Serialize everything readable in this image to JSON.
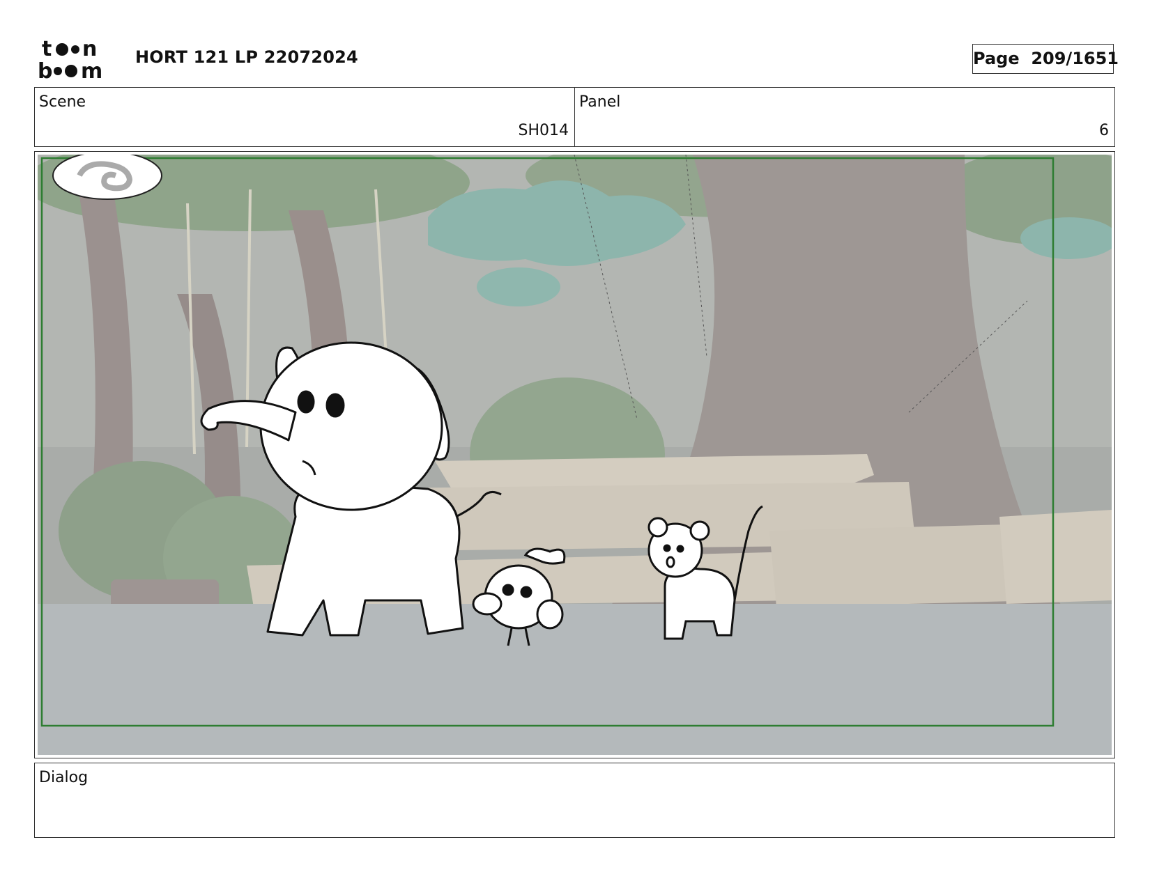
{
  "header": {
    "logo_text": "toon boom",
    "project_title": "HORT 121 LP 22072024",
    "page_label": "Page",
    "page_number": "209/1651"
  },
  "info": {
    "scene_label": "Scene",
    "scene_value": "SH014",
    "panel_label": "Panel",
    "panel_value": "6"
  },
  "dialog": {
    "label": "Dialog",
    "text": ""
  },
  "colors": {
    "frame_border": "#333333",
    "safe_area_border": "#2e7d32",
    "ground": "#b4b9bb",
    "background_wash": "#a9aca9"
  }
}
